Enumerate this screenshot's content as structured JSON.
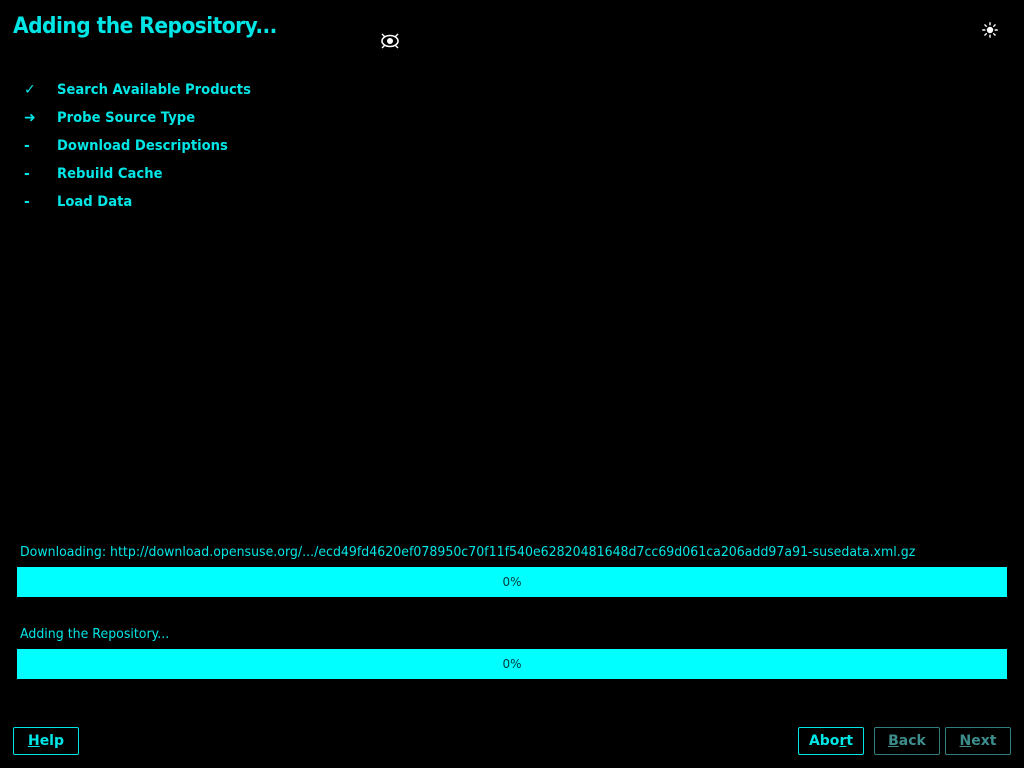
{
  "header": {
    "title": "Adding the Repository...",
    "icons": [
      "eye-icon",
      "sun-icon"
    ]
  },
  "steps": [
    {
      "marker": "✓",
      "status": "done",
      "label": "Search Available Products"
    },
    {
      "marker": "➜",
      "status": "current",
      "label": "Probe Source Type"
    },
    {
      "marker": "-",
      "status": "pending",
      "label": "Download Descriptions"
    },
    {
      "marker": "-",
      "status": "pending",
      "label": "Rebuild Cache"
    },
    {
      "marker": "-",
      "status": "pending",
      "label": "Load Data"
    }
  ],
  "download": {
    "label": "Downloading: http://download.opensuse.org/.../ecd49fd4620ef078950c70f11f540e62820481648d7cc69d061ca206add97a91-susedata.xml.gz",
    "percent_text": "0%",
    "progress": 0
  },
  "overall": {
    "label": "Adding the Repository...",
    "percent_text": "0%",
    "progress": 0
  },
  "buttons": {
    "help": {
      "label": "Help",
      "hotkey_index": 0,
      "enabled": true
    },
    "abort": {
      "label": "Abort",
      "hotkey_index": 3,
      "enabled": true
    },
    "back": {
      "label": "Back",
      "hotkey_index": 0,
      "enabled": false
    },
    "next": {
      "label": "Next",
      "hotkey_index": 0,
      "enabled": false
    }
  },
  "colors": {
    "background": "#000000",
    "text": "#00e6e6",
    "bar": "#00ffff",
    "disabled": "#3d8d8d"
  }
}
